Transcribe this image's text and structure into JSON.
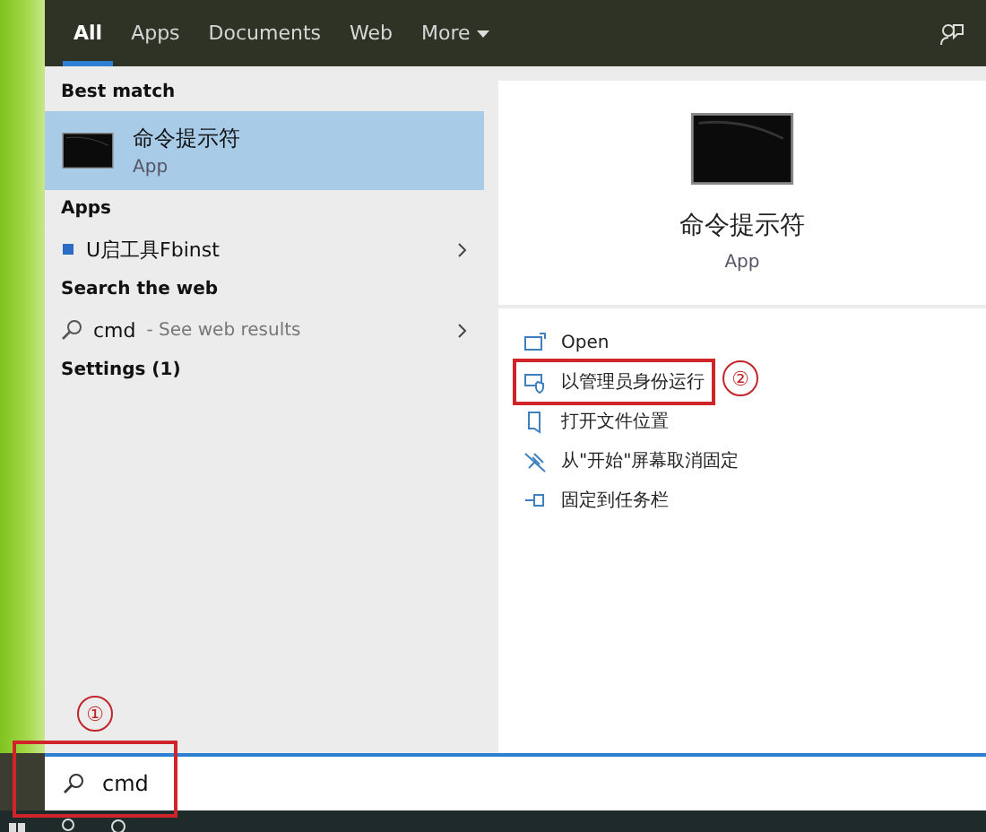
{
  "tabs": [
    {
      "label": "All",
      "selected": true
    },
    {
      "label": "Apps",
      "selected": false
    },
    {
      "label": "Documents",
      "selected": false
    },
    {
      "label": "Web",
      "selected": false
    },
    {
      "label": "More",
      "selected": false,
      "dropdown": true
    }
  ],
  "results": [
    {
      "kind": "header",
      "label": "Best match"
    },
    {
      "kind": "best",
      "title": "命令提示符",
      "subtitle": "App",
      "selected": true
    },
    {
      "kind": "header",
      "label": "Apps"
    },
    {
      "kind": "app",
      "title": "U启工具Fbinst",
      "selected": false
    },
    {
      "kind": "header",
      "label": "Search the web"
    },
    {
      "kind": "web",
      "title": "cmd",
      "subtitle": "- See web results",
      "selected": false
    },
    {
      "kind": "header",
      "label": "Settings (1)"
    }
  ],
  "preview": {
    "title": "命令提示符",
    "subtitle": "App"
  },
  "actions": [
    {
      "kind": "open",
      "label": "Open",
      "highlighted": false
    },
    {
      "kind": "admin",
      "label": "以管理员身份运行",
      "highlighted": true
    },
    {
      "kind": "folder",
      "label": "打开文件位置",
      "highlighted": false
    },
    {
      "kind": "unpin",
      "label": "从\"开始\"屏幕取消固定",
      "highlighted": false
    },
    {
      "kind": "pin",
      "label": "固定到任务栏",
      "highlighted": false
    }
  ],
  "search": {
    "value": "cmd",
    "highlighted": true
  },
  "annotations": [
    {
      "label": "①"
    },
    {
      "label": "②"
    }
  ]
}
